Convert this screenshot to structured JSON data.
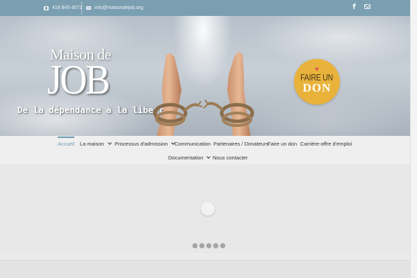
{
  "topbar": {
    "phone": "418 845-3072",
    "email": "info@maisondejob.org",
    "phone_icon": "phone-icon",
    "email_icon": "envelope-icon",
    "social": [
      {
        "icon": "facebook-icon",
        "glyph": "f"
      },
      {
        "icon": "mail-icon"
      }
    ],
    "background": "#7a9fb1"
  },
  "banner": {
    "logo_line1": "Maison de",
    "logo_line2": "JOB",
    "tagline": "De la dépendance à la liberté",
    "donate_badge": {
      "line1": "FAIRE UN",
      "line2": "DON",
      "heart": "♥",
      "color": "#e9b33b"
    }
  },
  "nav": {
    "accent": "#6d9ab0",
    "items": [
      {
        "label": "Accueil",
        "active": true,
        "dropdown": false
      },
      {
        "label": "La maison",
        "active": false,
        "dropdown": true
      },
      {
        "label": "Processus d'admission",
        "active": false,
        "dropdown": true
      },
      {
        "label": "Communication",
        "active": false,
        "dropdown": false
      },
      {
        "label": "Partenaires / Donateurs",
        "active": false,
        "dropdown": false
      },
      {
        "label": "Faire un don",
        "active": false,
        "dropdown": false
      },
      {
        "label": "Carrière-offre d'emploi",
        "active": false,
        "dropdown": false
      },
      {
        "label": "Documentation",
        "active": false,
        "dropdown": true
      },
      {
        "label": "Nous contacter",
        "active": false,
        "dropdown": false
      }
    ]
  },
  "slider": {
    "slide_count": 5
  }
}
